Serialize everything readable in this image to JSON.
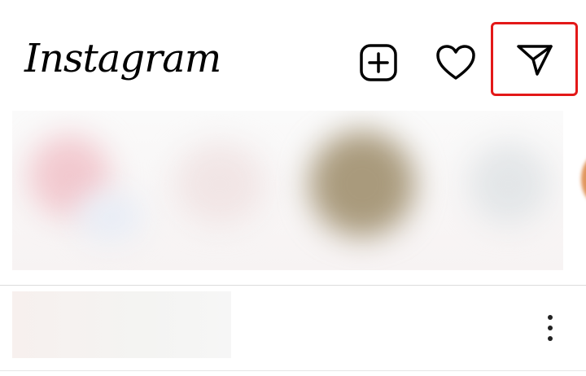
{
  "header": {
    "logo_text": "Instagram",
    "icons": {
      "new_post": "plus-square-icon",
      "activity": "heart-icon",
      "direct": "paper-plane-icon"
    }
  },
  "highlight_color": "#e31818",
  "post": {
    "more_icon": "more-vertical-icon"
  }
}
